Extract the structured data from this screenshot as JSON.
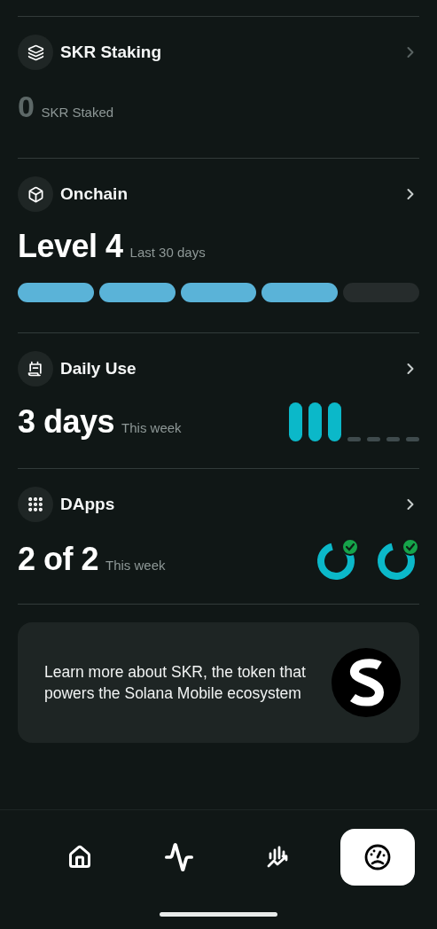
{
  "sections": [
    {
      "kind": "staking",
      "title": "SKR Staking",
      "value": "0",
      "caption": "SKR Staked",
      "disabled": true
    },
    {
      "kind": "level",
      "title": "Onchain",
      "value": "Level 4",
      "caption": "Last 30 days",
      "disabled": false,
      "segments": [
        {
          "filled": true
        },
        {
          "filled": true
        },
        {
          "filled": true
        },
        {
          "filled": true
        },
        {
          "filled": false
        }
      ]
    },
    {
      "kind": "daily",
      "title": "Daily Use",
      "value": "3 days",
      "caption": "This week",
      "disabled": false,
      "days": [
        {
          "active": true
        },
        {
          "active": true
        },
        {
          "active": true
        },
        {
          "active": false
        },
        {
          "active": false
        },
        {
          "active": false
        },
        {
          "active": false
        }
      ]
    },
    {
      "kind": "dapps",
      "title": "DApps",
      "value": "2 of 2",
      "caption": "This week",
      "disabled": false,
      "dapps": [
        {
          "completed": true
        },
        {
          "completed": true
        }
      ]
    }
  ],
  "promo": {
    "text": "Learn more about SKR, the token that powers the Solana Mobile ecosystem"
  },
  "nav": [
    {
      "kind": "home",
      "selected": false
    },
    {
      "kind": "activity",
      "selected": false
    },
    {
      "kind": "markets",
      "selected": false
    },
    {
      "kind": "score",
      "selected": true
    }
  ]
}
